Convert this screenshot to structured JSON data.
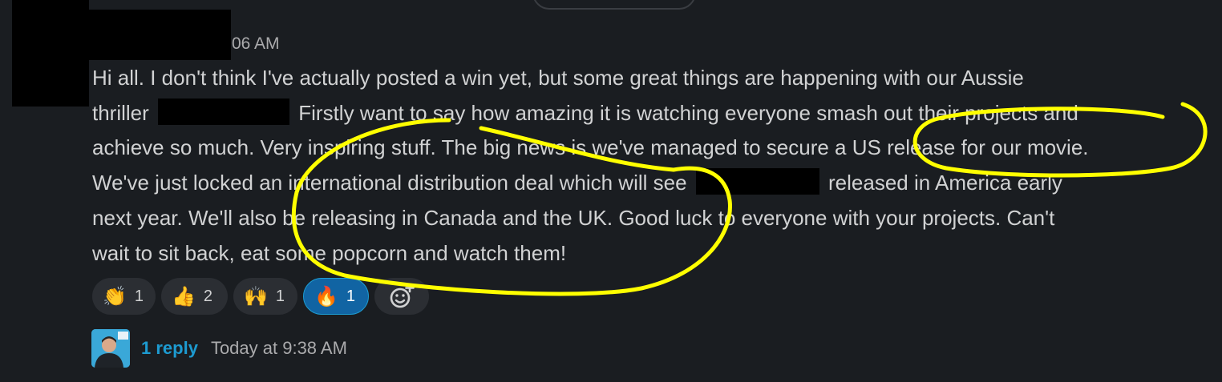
{
  "message": {
    "timestamp": "06 AM",
    "line1": "Hi all. I don't think I've actually posted a win yet, but some great things are happening with our Aussie",
    "line2a": "thriller",
    "line2b": "Firstly want to say how amazing it is watching everyone smash out their projects and",
    "line3": "achieve so much. Very inspiring stuff. The big news is we've managed to secure a US release for our movie.",
    "line4a": "We've just locked an international distribution deal which will see",
    "line4b": "released in America early",
    "line5": "next year. We'll also be releasing in Canada and the UK. Good luck to everyone with your projects. Can't",
    "line6": "wait to sit back, eat some popcorn and watch them!"
  },
  "reactions": [
    {
      "emoji": "👏",
      "count": "1"
    },
    {
      "emoji": "👍",
      "count": "2"
    },
    {
      "emoji": "🙌",
      "count": "1"
    },
    {
      "emoji": "🔥",
      "count": "1"
    }
  ],
  "thread": {
    "reply_label": "1 reply",
    "time": "Today at 9:38 AM"
  },
  "colors": {
    "background": "#1a1d21",
    "text": "#d1d2d3",
    "link": "#1d9bd1",
    "active_reaction": "#1164a3",
    "annotation": "#ffff00"
  }
}
